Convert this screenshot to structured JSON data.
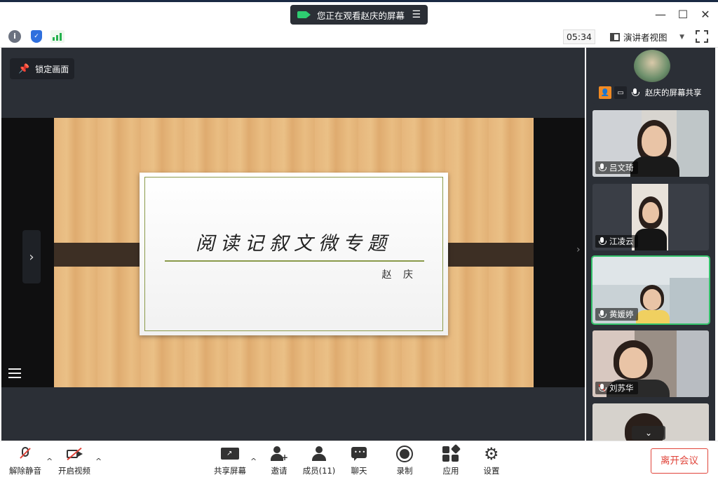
{
  "titlebar": {
    "share_status": "您正在观看赵庆的屏幕",
    "min_label": "—",
    "max_label": "☐",
    "close_label": "✕"
  },
  "statusbar": {
    "timer": "05:34",
    "view_mode": "演讲者视图"
  },
  "stage": {
    "pin_label": "锁定画面",
    "slide_title": "阅读记叙文微专题",
    "slide_author": "赵 庆"
  },
  "sidebar": {
    "tiles": [
      {
        "name": "赵庆的屏幕共享",
        "muted": false
      },
      {
        "name": "吕文琦",
        "muted": false
      },
      {
        "name": "江凌云",
        "muted": false
      },
      {
        "name": "黄媛婷",
        "muted": false,
        "active": true
      },
      {
        "name": "刘苏华",
        "muted": true
      }
    ]
  },
  "toolbar": {
    "unmute": "解除静音",
    "start_video": "开启视频",
    "share_screen": "共享屏幕",
    "invite": "邀请",
    "members": "成员(11)",
    "chat": "聊天",
    "record": "录制",
    "apps": "应用",
    "settings": "设置",
    "leave": "离开会议"
  },
  "colors": {
    "dark_bg": "#2b2f36",
    "accent_green": "#33c26b",
    "danger_red": "#e0443a"
  }
}
